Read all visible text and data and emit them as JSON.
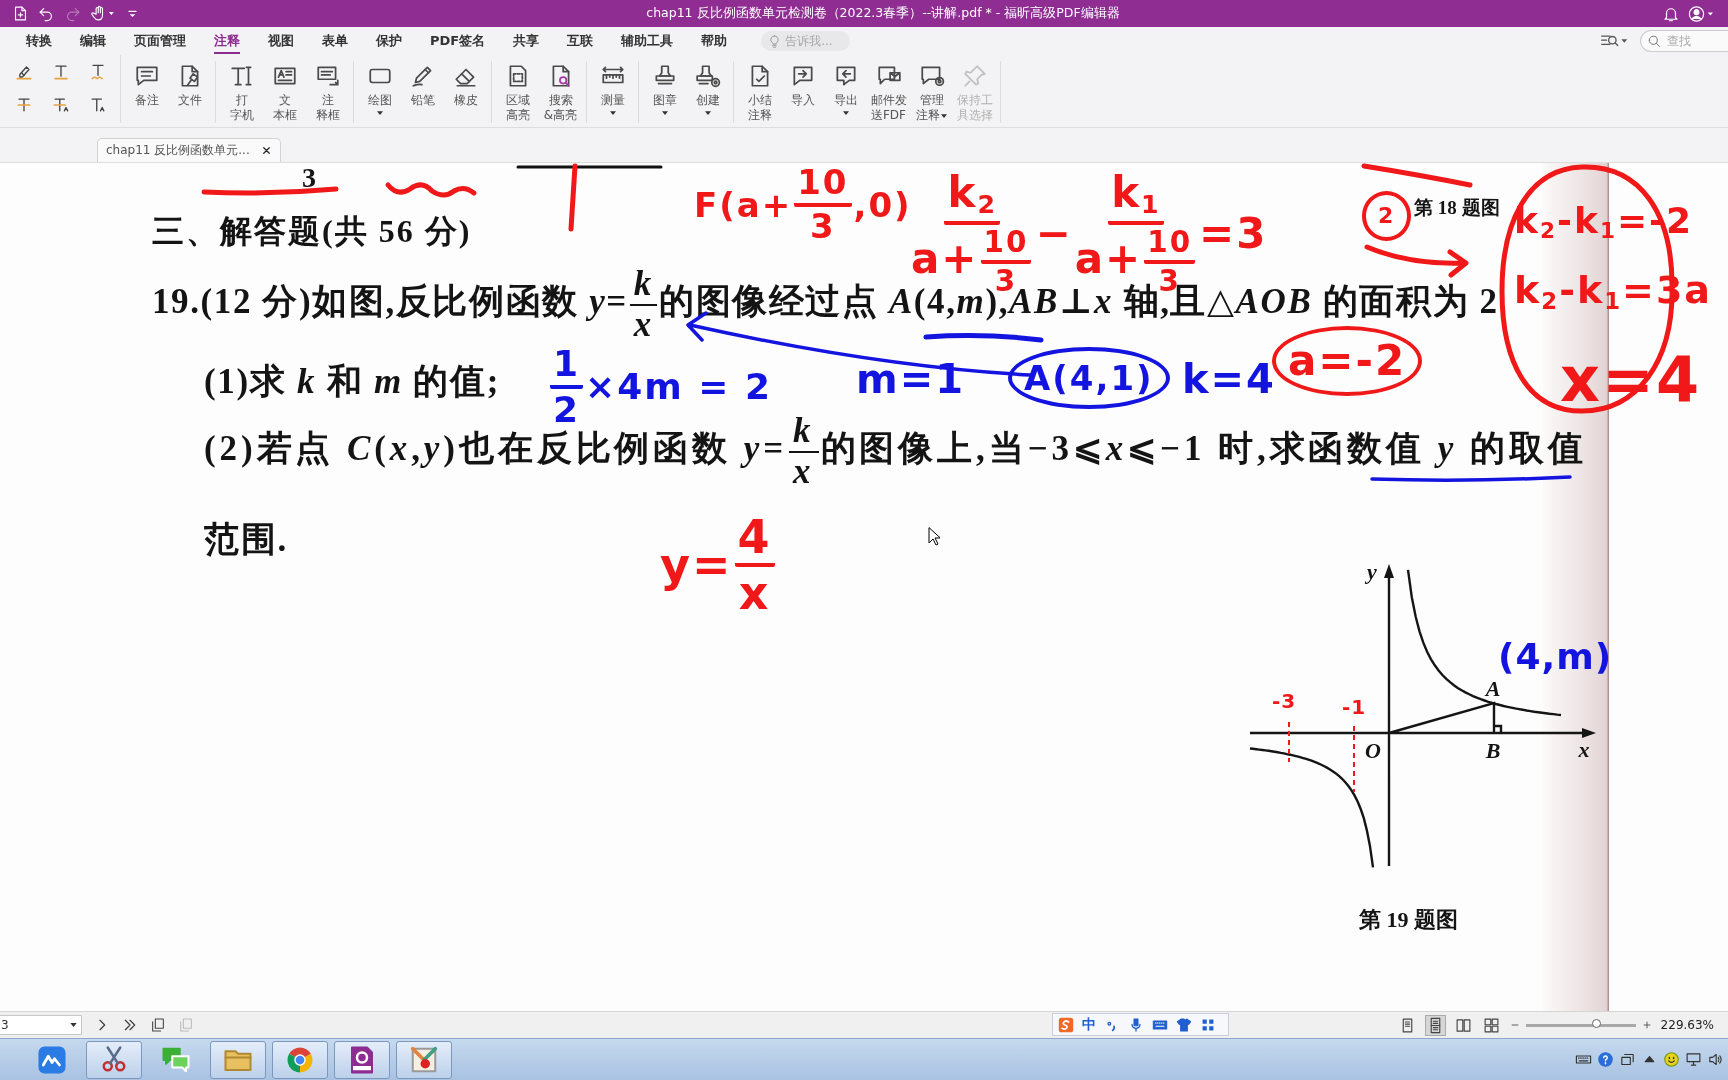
{
  "window": {
    "title": "chap11 反比例函数单元检测卷（2022.3春季）--讲解.pdf * - 福昕高级PDF编辑器"
  },
  "quick_access": [
    {
      "kind": "new",
      "disabled": false
    },
    {
      "kind": "undo",
      "disabled": false
    },
    {
      "kind": "redo",
      "disabled": true
    },
    {
      "kind": "hand",
      "disabled": false
    },
    {
      "kind": "customize",
      "disabled": false
    }
  ],
  "menu_tabs": [
    {
      "label": "转换",
      "selected": false
    },
    {
      "label": "编辑",
      "selected": false
    },
    {
      "label": "页面管理",
      "selected": false
    },
    {
      "label": "注释",
      "selected": true
    },
    {
      "label": "视图",
      "selected": false
    },
    {
      "label": "表单",
      "selected": false
    },
    {
      "label": "保护",
      "selected": false
    },
    {
      "label": "PDF签名",
      "selected": false
    },
    {
      "label": "共享",
      "selected": false
    },
    {
      "label": "互联",
      "selected": false
    },
    {
      "label": "辅助工具",
      "selected": false
    },
    {
      "label": "帮助",
      "selected": false
    }
  ],
  "tell_me": {
    "placeholder": "告诉我..."
  },
  "search": {
    "placeholder": "查找"
  },
  "ribbon": [
    {
      "kind": "small",
      "tools": [
        {
          "kind": "highlight"
        },
        {
          "kind": "underline"
        },
        {
          "kind": "squiggly"
        },
        {
          "kind": "strikeout"
        },
        {
          "kind": "replace"
        },
        {
          "kind": "insert"
        }
      ]
    },
    {
      "kind": "large",
      "tools": [
        {
          "kind": "comment",
          "label_lines": [
            "备注"
          ],
          "dropdown": false,
          "disabled": false
        },
        {
          "kind": "file",
          "label_lines": [
            "文件"
          ],
          "dropdown": false,
          "disabled": false
        }
      ]
    },
    {
      "kind": "large",
      "tools": [
        {
          "kind": "typewriter",
          "label_lines": [
            "打",
            "字机"
          ],
          "dropdown": false,
          "disabled": false
        },
        {
          "kind": "textbox",
          "label_lines": [
            "文",
            "本框"
          ],
          "dropdown": false,
          "disabled": false
        },
        {
          "kind": "callout",
          "label_lines": [
            "注",
            "释框"
          ],
          "dropdown": false,
          "disabled": false
        }
      ]
    },
    {
      "kind": "large",
      "tools": [
        {
          "kind": "shape",
          "label_lines": [
            "绘图"
          ],
          "dropdown": true,
          "disabled": false
        },
        {
          "kind": "pencil",
          "label_lines": [
            "铅笔"
          ],
          "dropdown": false,
          "disabled": false
        },
        {
          "kind": "eraser",
          "label_lines": [
            "橡皮"
          ],
          "dropdown": false,
          "disabled": false
        }
      ]
    },
    {
      "kind": "large",
      "tools": [
        {
          "kind": "area",
          "label_lines": [
            "区域",
            "高亮"
          ],
          "dropdown": false,
          "disabled": false
        },
        {
          "kind": "find",
          "label_lines": [
            "搜索",
            "&高亮"
          ],
          "dropdown": false,
          "disabled": false
        }
      ]
    },
    {
      "kind": "large",
      "tools": [
        {
          "kind": "measure",
          "label_lines": [
            "测量"
          ],
          "dropdown": true,
          "disabled": false
        }
      ]
    },
    {
      "kind": "large",
      "tools": [
        {
          "kind": "stamp",
          "label_lines": [
            "图章"
          ],
          "dropdown": true,
          "disabled": false
        },
        {
          "kind": "create",
          "label_lines": [
            "创建"
          ],
          "dropdown": true,
          "disabled": false
        }
      ]
    },
    {
      "kind": "large",
      "tools": [
        {
          "kind": "summary",
          "label_lines": [
            "小结",
            "注释"
          ],
          "dropdown": false,
          "disabled": false
        },
        {
          "kind": "import",
          "label_lines": [
            "导入"
          ],
          "dropdown": false,
          "disabled": false
        },
        {
          "kind": "export",
          "label_lines": [
            "导出"
          ],
          "dropdown": true,
          "disabled": false
        },
        {
          "kind": "email",
          "label_lines": [
            "邮件发",
            "送FDF"
          ],
          "dropdown": false,
          "disabled": false
        },
        {
          "kind": "manage",
          "label_lines": [
            "管理",
            "注释"
          ],
          "dropdown": true,
          "disabled": false
        },
        {
          "kind": "pin",
          "label_lines": [
            "保持工",
            "具选择"
          ],
          "dropdown": false,
          "disabled": true
        }
      ]
    }
  ],
  "document_tab": {
    "title": "chap11 反比例函数单元..."
  },
  "page": {
    "fragment": "3",
    "section_title": "三、解答题(共 56 分)",
    "figure_18_caption": "第 18 题图",
    "question_lines": [
      {
        "segments": [
          {
            "kind": "text",
            "text": "19.(12 分)如图,反比例函数 *y*="
          },
          {
            "kind": "fraction",
            "numerator": [
              {
                "kind": "text",
                "text": "*k*"
              }
            ],
            "denominator": [
              {
                "kind": "text",
                "text": "*x*"
              }
            ]
          },
          {
            "kind": "text",
            "text": "的图像经过点 *A*(4,*m*),*AB*⊥*x* 轴,且△*AOB* 的面积为 2"
          }
        ]
      },
      {
        "segments": [
          {
            "kind": "text",
            "text": "(1)求 *k* 和 *m* 的值;"
          }
        ]
      },
      {
        "segments": [
          {
            "kind": "text",
            "text": "(2)若点 *C*(*x*,*y*)也在反比例函数 *y*="
          },
          {
            "kind": "fraction",
            "numerator": [
              {
                "kind": "text",
                "text": "*k*"
              }
            ],
            "denominator": [
              {
                "kind": "text",
                "text": "*x*"
              }
            ]
          },
          {
            "kind": "text",
            "text": "的图像上,当−3⩽*x*⩽−1 时,求函数值 *y* 的取值"
          }
        ]
      },
      {
        "segments": [
          {
            "kind": "text",
            "text": "范围."
          }
        ]
      }
    ],
    "annotations": [
      {
        "color": "#f01818",
        "circled": false,
        "parts": [
          {
            "kind": "text",
            "text": "F(a+"
          },
          {
            "kind": "fraction",
            "numerator": [
              {
                "kind": "text",
                "text": "10"
              }
            ],
            "denominator": [
              {
                "kind": "text",
                "text": "3"
              }
            ]
          },
          {
            "kind": "text",
            "text": ",0)"
          }
        ]
      },
      {
        "color": "#f01818",
        "circled": false,
        "parts": [
          {
            "kind": "fraction",
            "numerator": [
              {
                "kind": "text",
                "text": "k$_{2}$"
              }
            ],
            "denominator": [
              {
                "kind": "text",
                "text": "a+"
              },
              {
                "kind": "fraction",
                "numerator": [
                  {
                    "kind": "text",
                    "text": "10"
                  }
                ],
                "denominator": [
                  {
                    "kind": "text",
                    "text": "3"
                  }
                ]
              }
            ]
          },
          {
            "kind": "text",
            "text": " − "
          },
          {
            "kind": "fraction",
            "numerator": [
              {
                "kind": "text",
                "text": "k$_{1}$"
              }
            ],
            "denominator": [
              {
                "kind": "text",
                "text": "a+"
              },
              {
                "kind": "fraction",
                "numerator": [
                  {
                    "kind": "text",
                    "text": "10"
                  }
                ],
                "denominator": [
                  {
                    "kind": "text",
                    "text": "3"
                  }
                ]
              }
            ]
          },
          {
            "kind": "text",
            "text": " =3"
          }
        ]
      },
      {
        "color": "#f01818",
        "circled": true,
        "parts": [
          {
            "kind": "text",
            "text": "2"
          }
        ]
      },
      {
        "color": "#f01818",
        "circled": false,
        "parts": [
          {
            "kind": "text",
            "text": "k$_{2}$-k$_{1}$=-2"
          }
        ]
      },
      {
        "color": "#f01818",
        "circled": false,
        "parts": [
          {
            "kind": "text",
            "text": "k$_{2}$-k$_{1}$=3a"
          }
        ]
      },
      {
        "color": "#1414e0",
        "circled": false,
        "parts": [
          {
            "kind": "fraction",
            "numerator": [
              {
                "kind": "text",
                "text": "1"
              }
            ],
            "denominator": [
              {
                "kind": "text",
                "text": "2"
              }
            ]
          },
          {
            "kind": "text",
            "text": "×4m = 2"
          }
        ]
      },
      {
        "color": "#1414e0",
        "circled": false,
        "parts": [
          {
            "kind": "text",
            "text": "m=1"
          }
        ]
      },
      {
        "color": "#1414e0",
        "circled": true,
        "parts": [
          {
            "kind": "text",
            "text": "A(4,1)"
          }
        ]
      },
      {
        "color": "#1414e0",
        "circled": false,
        "parts": [
          {
            "kind": "text",
            "text": "k=4"
          }
        ]
      },
      {
        "color": "#f01818",
        "circled": true,
        "parts": [
          {
            "kind": "text",
            "text": "a=-2"
          }
        ]
      },
      {
        "color": "#f01818",
        "circled": false,
        "parts": [
          {
            "kind": "text",
            "text": "x=4"
          }
        ]
      },
      {
        "color": "#f01818",
        "circled": false,
        "parts": [
          {
            "kind": "text",
            "text": "y="
          },
          {
            "kind": "fraction",
            "numerator": [
              {
                "kind": "text",
                "text": "4"
              }
            ],
            "denominator": [
              {
                "kind": "text",
                "text": "x"
              }
            ]
          }
        ]
      }
    ],
    "figure": {
      "y_axis": "y",
      "x_axis": "x",
      "origin": "O",
      "point_a": "A",
      "point_b": "B",
      "caption": "第 19 题图",
      "annotations": [
        {
          "color": "#f01818",
          "circled": false,
          "parts": [
            {
              "kind": "text",
              "text": "-3"
            }
          ]
        },
        {
          "color": "#f01818",
          "circled": false,
          "parts": [
            {
              "kind": "text",
              "text": "-1"
            }
          ]
        },
        {
          "color": "#1414e0",
          "circled": false,
          "parts": [
            {
              "kind": "text",
              "text": "(4,m)"
            }
          ]
        }
      ]
    }
  },
  "status_bar": {
    "page_number": "3",
    "ime": {
      "mode": "中"
    },
    "view_modes": [
      {
        "kind": "single",
        "selected": false
      },
      {
        "kind": "continuous",
        "selected": true
      },
      {
        "kind": "facing",
        "selected": false
      },
      {
        "kind": "grid",
        "selected": false
      }
    ],
    "zoom": {
      "level": 0.65,
      "reading": "229.63%"
    }
  },
  "taskbar": {
    "apps": [
      {
        "kind": "cloud",
        "running": false
      },
      {
        "kind": "scissors",
        "running": true
      },
      {
        "kind": "chat",
        "running": false
      },
      {
        "kind": "folder",
        "running": true
      },
      {
        "kind": "browser",
        "running": true
      },
      {
        "kind": "pdf",
        "running": true
      },
      {
        "kind": "paint",
        "running": true
      }
    ]
  }
}
